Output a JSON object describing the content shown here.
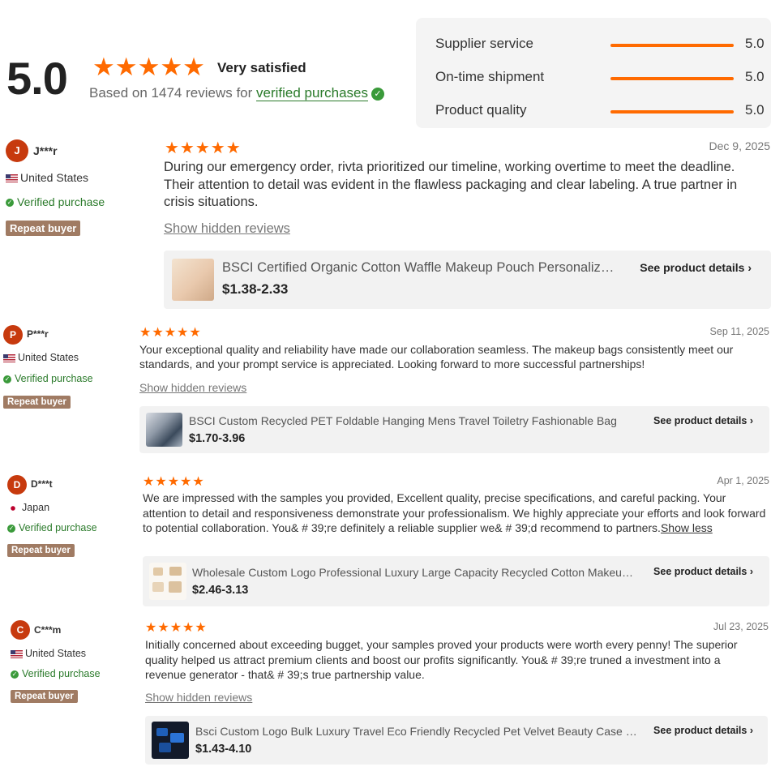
{
  "summary": {
    "score": "5.0",
    "stars": "★★★★★",
    "label": "Very satisfied",
    "based_prefix": "Based on 1474 reviews for ",
    "verified_link": "verified purchases",
    "verified_icon": "check-badge-icon"
  },
  "ratings": [
    {
      "label": "Supplier service",
      "value": "5.0",
      "fraction": 1.0
    },
    {
      "label": "On-time shipment",
      "value": "5.0",
      "fraction": 1.0
    },
    {
      "label": "Product quality",
      "value": "5.0",
      "fraction": 1.0
    }
  ],
  "colors": {
    "accent": "#ff6a00",
    "verified": "#2a7a2a",
    "avatar": "#c73a0e",
    "repeat_badge": "#a07b63"
  },
  "reviews": [
    {
      "avatar_letter": "J",
      "name": "J***r",
      "country": "United States",
      "flag": "us-flag-icon",
      "verified": "Verified purchase",
      "badge": "Repeat buyer",
      "stars": "★★★★★",
      "rating": 5,
      "date": "Dec 9, 2025",
      "text": "During our emergency order, rivta prioritized our timeline, working overtime to meet the deadline. Their attention to detail was evident in the flawless packaging and clear labeling. A true partner in crisis situations.",
      "show_hidden": "Show hidden reviews",
      "product": {
        "title": "BSCI Certified Organic Cotton Waffle Makeup Pouch Personalized Travel Cosmetic Bag",
        "price": "$1.38-2.33",
        "details": "See product details ›"
      }
    },
    {
      "avatar_letter": "P",
      "name": "P***r",
      "country": "United States",
      "flag": "us-flag-icon",
      "verified": "Verified purchase",
      "badge": "Repeat buyer",
      "stars": "★★★★★",
      "rating": 5,
      "date": "Sep 11, 2025",
      "text": "Your exceptional quality and reliability have made our collaboration seamless. The makeup bags consistently meet our standards, and your prompt service is appreciated. Looking forward to more successful partnerships!",
      "show_hidden": "Show hidden reviews",
      "product": {
        "title": "BSCI Custom Recycled PET Foldable Hanging Mens Travel Toiletry Fashionable Bag",
        "price": "$1.70-3.96",
        "details": "See product details ›"
      }
    },
    {
      "avatar_letter": "D",
      "name": "D***t",
      "country": "Japan",
      "flag": "japan-flag-icon",
      "verified": "Verified purchase",
      "badge": "Repeat buyer",
      "stars": "★★★★★",
      "rating": 5,
      "date": "Apr 1, 2025",
      "text": "We are impressed with the samples you provided,   Excellent quality, precise specifications, and careful packing. Your attention to detail and responsiveness demonstrate your professionalism. We highly appreciate your efforts and look forward to potential collaboration. You& # 39;re definitely a reliable supplier we& # 39;d recommend to partners.",
      "show_less": "Show less",
      "product": {
        "title": "Wholesale Custom Logo Professional Luxury Large Capacity Recycled Cotton Makeup Bag",
        "price": "$2.46-3.13",
        "details": "See product details ›"
      }
    },
    {
      "avatar_letter": "C",
      "name": "C***m",
      "country": "United States",
      "flag": "us-flag-icon",
      "verified": "Verified purchase",
      "badge": "Repeat buyer",
      "stars": "★★★★★",
      "rating": 5,
      "date": "Jul 23, 2025",
      "text": "Initially concerned about exceeding bugget, your samples proved your products were worth every penny! The superior quality helped us attract premium clients and boost our profits significantly. You& # 39;re truned a investment into a revenue generator - that& # 39;s true partnership value.",
      "show_hidden": "Show hidden reviews",
      "product": {
        "title": "Bsci Custom Logo Bulk Luxury Travel Eco Friendly Recycled Pet Velvet Beauty Case Bag",
        "price": "$1.43-4.10",
        "details": "See product details ›"
      }
    }
  ]
}
